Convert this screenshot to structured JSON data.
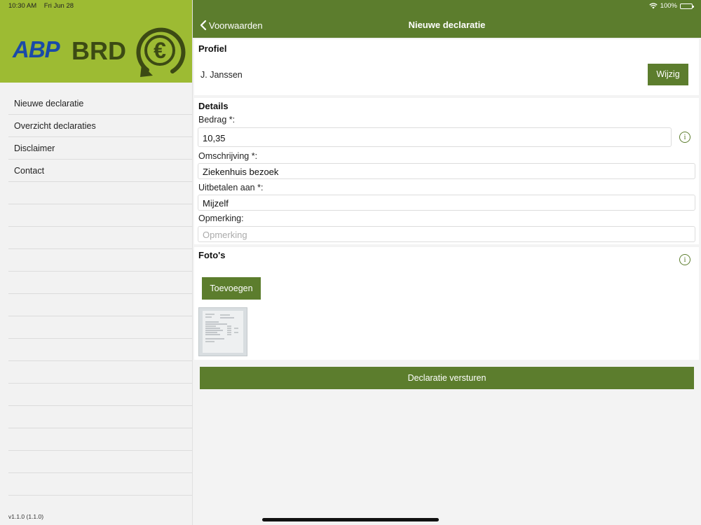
{
  "status_bar": {
    "time": "10:30 AM",
    "date": "Fri Jun 28",
    "battery": "100%",
    "battery_level": 1.0
  },
  "sidebar": {
    "logo": {
      "abp": "ABP",
      "brd": "BRD",
      "symbol": "€"
    },
    "items": [
      {
        "label": "Nieuwe declaratie"
      },
      {
        "label": "Overzicht declaraties"
      },
      {
        "label": "Disclaimer"
      },
      {
        "label": "Contact"
      }
    ],
    "version": "v1.1.0 (1.1.0)"
  },
  "navbar": {
    "back_label": "Voorwaarden",
    "title": "Nieuwe declaratie"
  },
  "profiel": {
    "title": "Profiel",
    "name": "J. Janssen",
    "edit_label": "Wijzig"
  },
  "details": {
    "title": "Details",
    "bedrag_label": "Bedrag *:",
    "bedrag_value": "10,35",
    "omschrijving_label": "Omschrijving *:",
    "omschrijving_value": "Ziekenhuis bezoek",
    "uitbetalen_label": "Uitbetalen aan *:",
    "uitbetalen_value": "Mijzelf",
    "opmerking_label": "Opmerking:",
    "opmerking_placeholder": "Opmerking"
  },
  "fotos": {
    "title": "Foto's",
    "add_label": "Toevoegen"
  },
  "submit_label": "Declaratie versturen",
  "colors": {
    "brand_green": "#5c7d2d",
    "logo_bg": "#9dbb33",
    "abp_blue": "#1a4aa8",
    "brd_dark": "#3c4a14"
  },
  "icons": {
    "back": "chevron-left-icon",
    "info": "info-icon",
    "wifi": "wifi-icon",
    "battery": "battery-icon",
    "euro": "euro-icon"
  }
}
